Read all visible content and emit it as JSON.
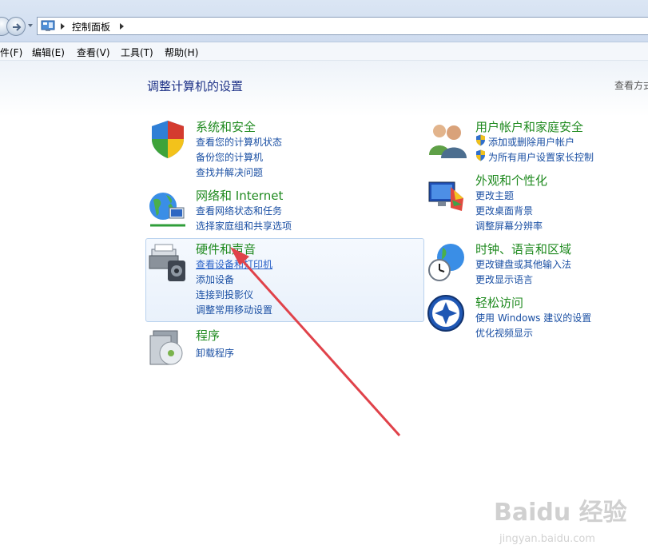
{
  "address_bar": {
    "breadcrumb": "控制面板"
  },
  "menu": [
    "件(F)",
    "编辑(E)",
    "查看(V)",
    "工具(T)",
    "帮助(H)"
  ],
  "main": {
    "title": "调整计算机的设置",
    "view_by": "查看方式"
  },
  "categories": [
    {
      "title": "系统和安全",
      "links": [
        "查看您的计算机状态",
        "备份您的计算机",
        "查找并解决问题"
      ]
    },
    {
      "title": "网络和 Internet",
      "links": [
        "查看网络状态和任务",
        "选择家庭组和共享选项"
      ]
    },
    {
      "title": "硬件和声音",
      "links": [
        "查看设备和打印机",
        "添加设备",
        "连接到投影仪",
        "调整常用移动设置"
      ]
    },
    {
      "title": "程序",
      "links": [
        "卸载程序"
      ]
    },
    {
      "title": "用户帐户和家庭安全",
      "links": [
        "添加或删除用户帐户",
        "为所有用户设置家长控制"
      ]
    },
    {
      "title": "外观和个性化",
      "links": [
        "更改主题",
        "更改桌面背景",
        "调整屏幕分辨率"
      ]
    },
    {
      "title": "时钟、语言和区域",
      "links": [
        "更改键盘或其他输入法",
        "更改显示语言"
      ]
    },
    {
      "title": "轻松访问",
      "links": [
        "使用 Windows 建议的设置",
        "优化视频显示"
      ]
    }
  ],
  "watermark": {
    "brand": "Baidu 经验",
    "url": "jingyan.baidu.com"
  },
  "colors": {
    "category_title": "#1f8a1f",
    "link": "#1a4fa3",
    "annotation_arrow": "#e0424a"
  }
}
